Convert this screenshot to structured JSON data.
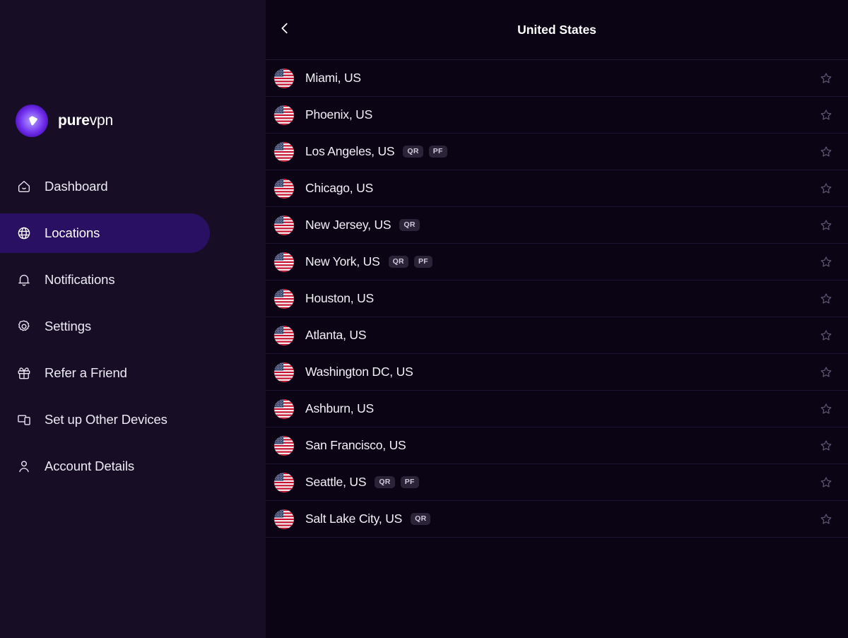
{
  "brand": {
    "name_bold": "pure",
    "name_light": "vpn",
    "logo_icon": "purevpn-shield-icon"
  },
  "sidebar": {
    "items": [
      {
        "label": "Dashboard",
        "icon": "home-icon",
        "active": false
      },
      {
        "label": "Locations",
        "icon": "globe-icon",
        "active": true
      },
      {
        "label": "Notifications",
        "icon": "bell-icon",
        "active": false
      },
      {
        "label": "Settings",
        "icon": "gear-icon",
        "active": false
      },
      {
        "label": "Refer a Friend",
        "icon": "gift-icon",
        "active": false
      },
      {
        "label": "Set up Other Devices",
        "icon": "devices-icon",
        "active": false
      },
      {
        "label": "Account Details",
        "icon": "user-icon",
        "active": false
      }
    ]
  },
  "header": {
    "title": "United States",
    "back_icon": "chevron-left-icon"
  },
  "locations": {
    "favorite_icon": "star-outline-icon",
    "flag_icon": "us-flag-icon",
    "rows": [
      {
        "city": "Miami, US",
        "badges": []
      },
      {
        "city": "Phoenix, US",
        "badges": []
      },
      {
        "city": "Los Angeles, US",
        "badges": [
          "QR",
          "PF"
        ]
      },
      {
        "city": "Chicago, US",
        "badges": []
      },
      {
        "city": "New Jersey, US",
        "badges": [
          "QR"
        ]
      },
      {
        "city": "New York, US",
        "badges": [
          "QR",
          "PF"
        ]
      },
      {
        "city": "Houston, US",
        "badges": []
      },
      {
        "city": "Atlanta, US",
        "badges": []
      },
      {
        "city": "Washington DC, US",
        "badges": []
      },
      {
        "city": "Ashburn, US",
        "badges": []
      },
      {
        "city": "San Francisco, US",
        "badges": []
      },
      {
        "city": "Seattle, US",
        "badges": [
          "QR",
          "PF"
        ]
      },
      {
        "city": "Salt Lake City, US",
        "badges": [
          "QR"
        ]
      }
    ]
  },
  "colors": {
    "sidebar_bg": "#170e26",
    "main_bg": "#0b0415",
    "active_pill": "#2a1063",
    "accent": "#7637ef",
    "badge_bg": "#2b2438",
    "row_divider": "#1d1530",
    "text_primary": "#f2f0f7"
  }
}
